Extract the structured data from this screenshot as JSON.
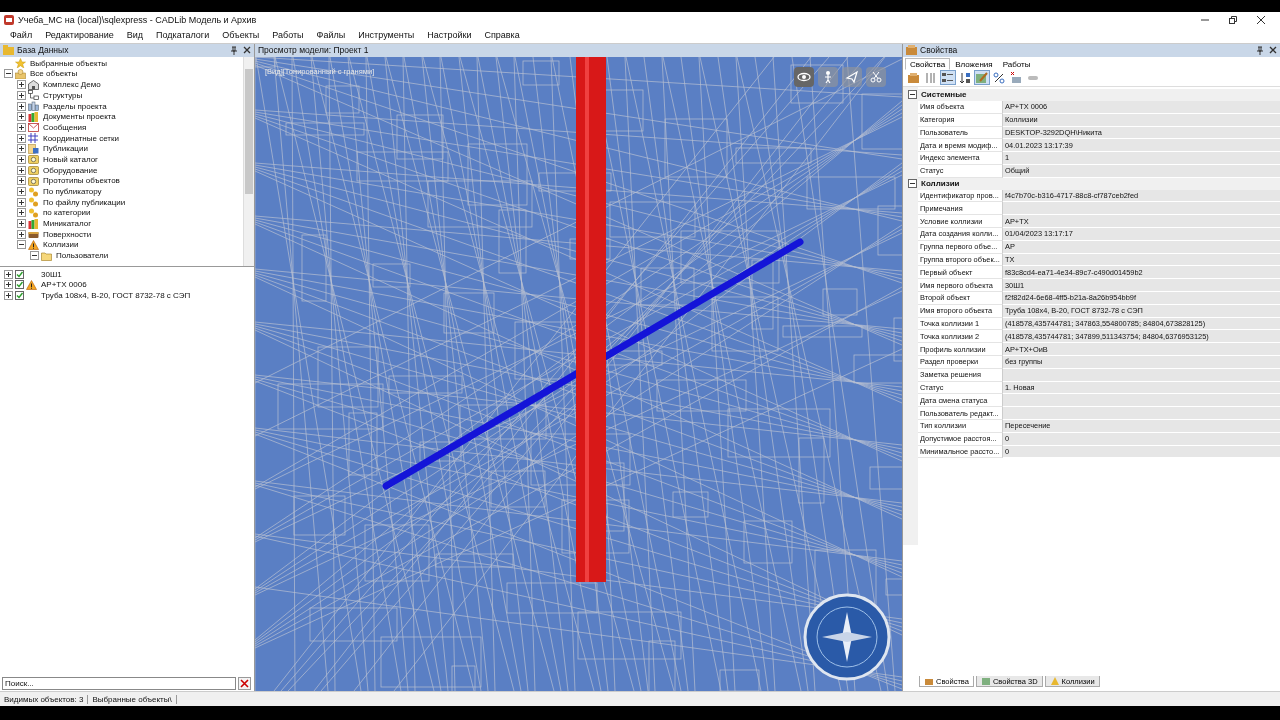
{
  "window": {
    "title": "Учеба_МС на (local)\\sqlexpress - CADLib Модель и Архив"
  },
  "menu": [
    "Файл",
    "Редактирование",
    "Вид",
    "Подкаталоги",
    "Объекты",
    "Работы",
    "Файлы",
    "Инструменты",
    "Настройки",
    "Справка"
  ],
  "database_panel": {
    "title": "База Данных",
    "tree": [
      {
        "label": "Выбранные объекты",
        "kind": "star",
        "expandable": false
      },
      {
        "label": "Все объекты",
        "kind": "users",
        "expandable": true,
        "expanded": true,
        "children": [
          {
            "label": "Комплекс Демо",
            "kind": "building",
            "expandable": true,
            "expanded": false
          },
          {
            "label": "Структуры",
            "kind": "structure",
            "expandable": true,
            "expanded": false
          },
          {
            "label": "Разделы проекта",
            "kind": "sections",
            "expandable": true,
            "expanded": false
          },
          {
            "label": "Документы проекта",
            "kind": "documents",
            "expandable": true,
            "expanded": false
          },
          {
            "label": "Сообщения",
            "kind": "messages",
            "expandable": true,
            "expanded": false
          },
          {
            "label": "Координатные сетки",
            "kind": "grid",
            "expandable": true,
            "expanded": false
          },
          {
            "label": "Публикации",
            "kind": "publication",
            "expandable": true,
            "expanded": false
          },
          {
            "label": "Новый каталог",
            "kind": "catalog",
            "expandable": true,
            "expanded": false
          },
          {
            "label": "Оборудование",
            "kind": "catalog",
            "expandable": true,
            "expanded": false
          },
          {
            "label": "Прототипы объектов",
            "kind": "catalog",
            "expandable": true,
            "expanded": false
          },
          {
            "label": "По публикатору",
            "kind": "group",
            "expandable": true,
            "expanded": false
          },
          {
            "label": "По файлу публикации",
            "kind": "group",
            "expandable": true,
            "expanded": false
          },
          {
            "label": "по категории",
            "kind": "group",
            "expandable": true,
            "expanded": false
          },
          {
            "label": "Миникаталог",
            "kind": "documents",
            "expandable": true,
            "expanded": false
          },
          {
            "label": "Поверхности",
            "kind": "surface",
            "expandable": true,
            "expanded": false
          },
          {
            "label": "Коллизии",
            "kind": "warning",
            "expandable": true,
            "expanded": true,
            "children": [
              {
                "label": "Пользователи",
                "kind": "folder",
                "expandable": true,
                "expanded": true
              }
            ]
          }
        ]
      }
    ],
    "objects": [
      {
        "label": "30Ш1",
        "kind": "plain",
        "checked": true
      },
      {
        "label": "АР+ТХ 0006",
        "kind": "warning",
        "checked": true
      },
      {
        "label": "Труба 108х4, В-20, ГОСТ 8732-78 с СЭП",
        "kind": "plain",
        "checked": true
      }
    ],
    "search": {
      "placeholder": "Поиск..."
    }
  },
  "model_view": {
    "title": "Просмотр модели: Проект 1",
    "mode_label": "[Вид][Тонированный с гранями]"
  },
  "properties_panel": {
    "title": "Свойства",
    "tabs": [
      {
        "label": "Свойства",
        "selected": true
      },
      {
        "label": "Вложения",
        "selected": false
      },
      {
        "label": "Работы",
        "selected": false
      }
    ],
    "categories": [
      {
        "name": "Системные",
        "expanded": true,
        "rows": [
          {
            "name": "Имя объекта",
            "value": "АР+ТХ 0006"
          },
          {
            "name": "Категория",
            "value": "Коллизии"
          },
          {
            "name": "Пользователь",
            "value": "DESKTOP-3292DQH\\Никита"
          },
          {
            "name": "Дата и время модиф...",
            "value": "04.01.2023 13:17:39"
          },
          {
            "name": "Индекс элемента",
            "value": "1"
          },
          {
            "name": "Статус",
            "value": "Общий"
          }
        ]
      },
      {
        "name": "Коллизии",
        "expanded": true,
        "rows": [
          {
            "name": "Идентификатор пров...",
            "value": "f4c7b70c-b316-4717-88c8-cf787ceb2fed"
          },
          {
            "name": "Примечания",
            "value": ""
          },
          {
            "name": "Условие коллизии",
            "value": "АР+ТХ"
          },
          {
            "name": "Дата создания колли...",
            "value": "01/04/2023 13:17:17"
          },
          {
            "name": "Группа первого объе...",
            "value": "АР"
          },
          {
            "name": "Группа второго объек...",
            "value": "ТХ"
          },
          {
            "name": "Первый объект",
            "value": "f83c8cd4-ea71-4e34-89c7-c490d01459b2"
          },
          {
            "name": "Имя первого объекта",
            "value": "30Ш1"
          },
          {
            "name": "Второй объект",
            "value": "f2f82d24-6e68-4ff5-b21a-8a26b954bb9f"
          },
          {
            "name": "Имя второго объекта",
            "value": "Труба 108х4, В-20, ГОСТ 8732-78 с СЭП"
          },
          {
            "name": "Точка коллизии 1",
            "value": "(418578,435744781; 347863,554800785; 84804,673828125)"
          },
          {
            "name": "Точка коллизии 2",
            "value": "(418578,435744781; 347899,511343754; 84804,6376953125)"
          },
          {
            "name": "Профиль коллизии",
            "value": "АР+ТХ+ОиВ"
          },
          {
            "name": "Раздел проверки",
            "value": "без группы"
          },
          {
            "name": "Заметка решения",
            "value": ""
          },
          {
            "name": "Статус",
            "value": "1. Новая"
          },
          {
            "name": "Дата смена статуса",
            "value": ""
          },
          {
            "name": "Пользователь редакт...",
            "value": ""
          },
          {
            "name": "Тип коллизии",
            "value": "Пересечение"
          },
          {
            "name": "Допустимое расстоя...",
            "value": "0"
          },
          {
            "name": "Минимальное рассто...",
            "value": "0"
          }
        ]
      }
    ],
    "bottom_tabs": [
      {
        "label": "Свойства",
        "selected": true
      },
      {
        "label": "Свойства 3D",
        "selected": false
      },
      {
        "label": "Коллизии",
        "selected": false
      }
    ]
  },
  "status_bar": [
    "Видимых объектов: 3",
    "Выбранные объекты\\"
  ]
}
